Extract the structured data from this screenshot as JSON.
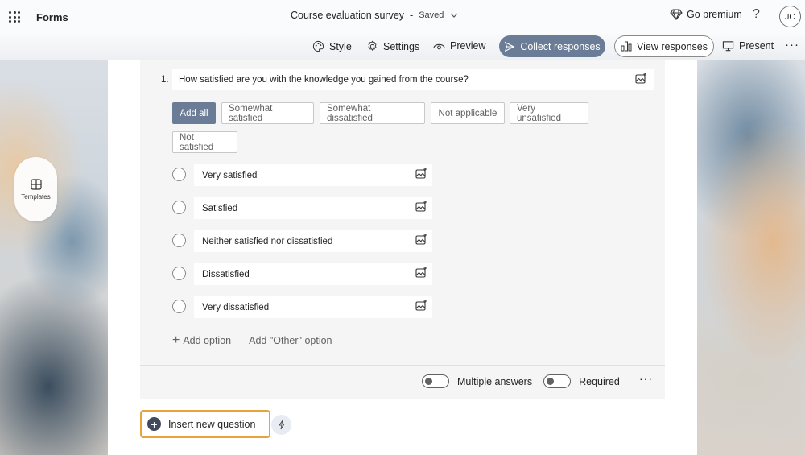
{
  "header": {
    "app_name": "Forms",
    "doc_title": "Course evaluation survey",
    "separator": "-",
    "status": "Saved",
    "premium": "Go premium",
    "help": "?",
    "avatar_initials": "JC"
  },
  "toolbar": {
    "style": "Style",
    "settings": "Settings",
    "preview": "Preview",
    "collect": "Collect responses",
    "view": "View responses",
    "present": "Present",
    "more": "···"
  },
  "sidebar": {
    "templates": "Templates"
  },
  "question": {
    "number": "1.",
    "text": "How satisfied are you with the knowledge you gained from the course?",
    "suggestions": {
      "add_all": "Add all",
      "chips": [
        "Somewhat satisfied",
        "Somewhat dissatisfied",
        "Not applicable",
        "Very unsatisfied",
        "Not satisfied"
      ]
    },
    "options": [
      "Very satisfied",
      "Satisfied",
      "Neither satisfied nor dissatisfied",
      "Dissatisfied",
      "Very dissatisfied"
    ],
    "add_option": "Add option",
    "add_other": "Add \"Other\" option",
    "multiple_answers": "Multiple answers",
    "required": "Required",
    "more": "···"
  },
  "insert": {
    "label": "Insert new question"
  },
  "colors": {
    "accent": "#6b7c96",
    "focus_outline": "#e8a33d"
  }
}
